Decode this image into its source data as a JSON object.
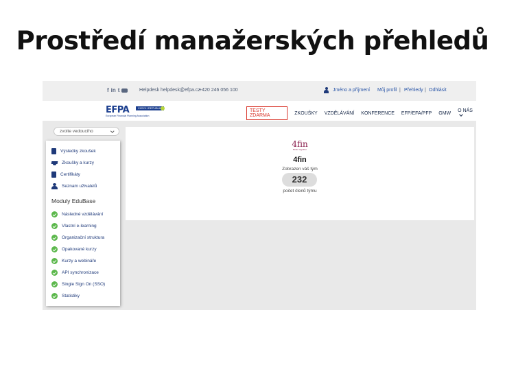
{
  "slide": {
    "title": "Prostředí manažerských přehledů"
  },
  "topbar": {
    "social": [
      "f",
      "in",
      "t"
    ],
    "helpdesk_label": "Helpdesk",
    "email": "helpdesk@efpa.cz",
    "phone": "+420 246 056 100",
    "user_name": "Jméno a příjmení",
    "links": [
      "Můj profil",
      "Přehledy",
      "Odhlásit"
    ],
    "separator": "|"
  },
  "logo": {
    "mark": "EFPA",
    "badge": "CZECH REPUBLIC",
    "subtitle": "European Financial Planning Association"
  },
  "nav": {
    "cta": "TESTY ZDARMA",
    "items": [
      "ZKOUŠKY",
      "VZDĚLÁVÁNÍ",
      "KONFERENCE",
      "EFP/EFA/PFP",
      "GMW",
      "O NÁS"
    ]
  },
  "selector": {
    "value": "zvolte vedoucího"
  },
  "sidebar": {
    "items": [
      {
        "label": "Výsledky zkoušek",
        "icon": "document-icon"
      },
      {
        "label": "Zkoušky a kurzy",
        "icon": "graduation-cap-icon"
      },
      {
        "label": "Certifikáty",
        "icon": "certificate-icon"
      },
      {
        "label": "Seznam uživatelů",
        "icon": "person-icon"
      }
    ],
    "section_title": "Moduly EduBase",
    "modules": [
      "Následné vzdělávání",
      "Vlastní e-learning",
      "Organizační struktura",
      "Opakované kurzy",
      "Kurzy a webináře",
      "API synchronizace",
      "Single Sign On (SSO)",
      "Statistiky"
    ]
  },
  "main": {
    "brand_logo": "4fin",
    "brand_tagline": "Better together",
    "team_name": "4fin",
    "shown_label": "Zobrazen váš tým",
    "member_count": "232",
    "count_label": "počet členů týmu"
  },
  "colors": {
    "brand_blue": "#1c3f8f",
    "cta_red": "#d9362b",
    "check_green": "#5cb84c",
    "brand_magenta": "#8b1f4e"
  }
}
